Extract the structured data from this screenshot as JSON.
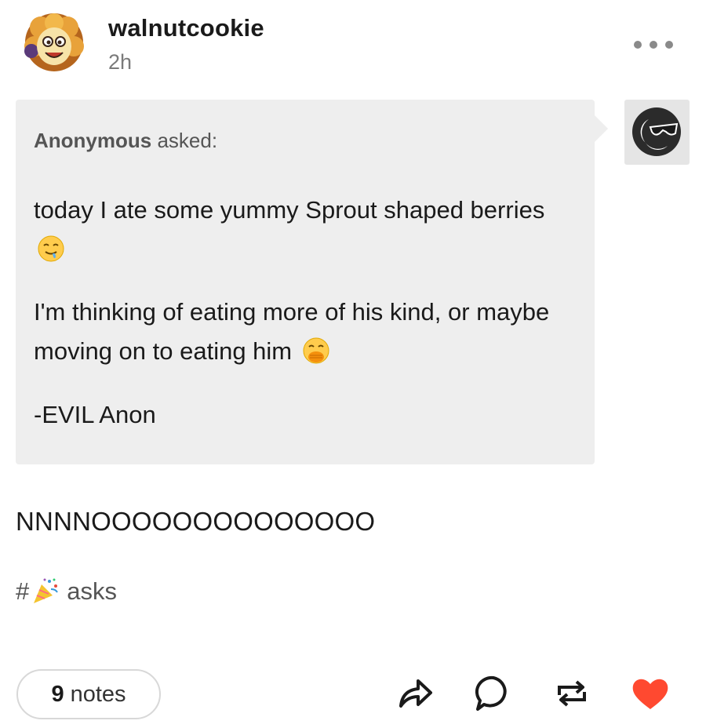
{
  "post": {
    "username": "walnutcookie",
    "timestamp": "2h",
    "ask": {
      "asker": "Anonymous",
      "asked_label": "asked:",
      "paragraphs": {
        "p1": "today I ate some yummy Sprout shaped berries",
        "p2": "I'm thinking of eating more of his kind, or maybe moving on to eating him",
        "p3": "-EVIL Anon"
      },
      "emoji": {
        "p1": "drooling-face",
        "p2": "face-with-hand-over-mouth"
      }
    },
    "answer": "NNNNOOOOOOOOOOOOOO",
    "tags": {
      "prefix": "#",
      "emoji": "party-popper",
      "text": "asks"
    },
    "footer": {
      "notes_count": "9",
      "notes_label": "notes",
      "icons": [
        "share-icon",
        "reply-icon",
        "reblog-icon",
        "like-icon"
      ]
    },
    "colors": {
      "like": "#ff4930",
      "bubble": "#eeeeee",
      "muted": "#7a7a7a"
    }
  }
}
